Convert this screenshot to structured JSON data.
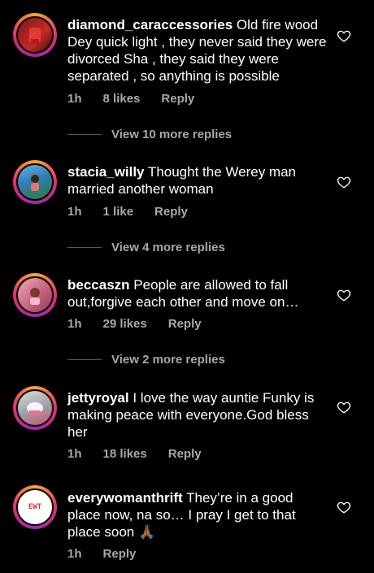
{
  "comments": [
    {
      "username": "diamond_caraccessories",
      "text": " Old fire wood Dey quick light , they never said they were divorced Sha , they said they were separated , so anything is possible",
      "time": "1h",
      "likes": "8 likes",
      "reply": "Reply",
      "more_replies": "View 10 more replies",
      "avatar_colors": [
        "#6b1414",
        "#c62828"
      ]
    },
    {
      "username": "stacia_willy",
      "text": " Thought the Werey man married another woman",
      "time": "1h",
      "likes": "1 like",
      "reply": "Reply",
      "more_replies": "View 4 more replies",
      "avatar_colors": [
        "#4a90c2",
        "#2e7d32"
      ]
    },
    {
      "username": "beccaszn",
      "text": " People are allowed to fall out,forgive each other and move on…",
      "time": "1h",
      "likes": "29 likes",
      "reply": "Reply",
      "more_replies": "View 2 more replies",
      "avatar_colors": [
        "#e88aa0",
        "#b85c6e"
      ]
    },
    {
      "username": "jettyroyal",
      "text": " I love the way auntie Funky is making peace with everyone.God bless her",
      "time": "1h",
      "likes": "18 likes",
      "reply": "Reply",
      "avatar_colors": [
        "#b0b0b8",
        "#d14b6b"
      ]
    },
    {
      "username": "everywomanthrift",
      "text": " They’re in a good place now, na so… I pray I get to that place soon 🙏🏾",
      "time": "1h",
      "reply": "Reply",
      "avatar_logo": "EWT",
      "avatar_colors": [
        "#ffffff",
        "#d32f2f"
      ]
    }
  ]
}
